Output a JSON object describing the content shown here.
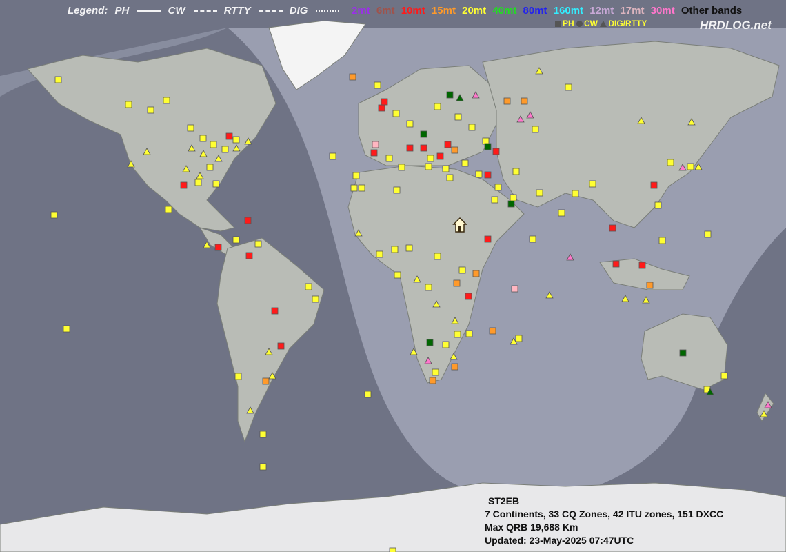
{
  "legend": {
    "label": "Legend:",
    "ph": "PH",
    "cw": "CW",
    "rtty": "RTTY",
    "dig": "DIG"
  },
  "bands": [
    {
      "label": "2mt",
      "color": "#9b30e8"
    },
    {
      "label": "6mt",
      "color": "#a0524a"
    },
    {
      "label": "10mt",
      "color": "#ff1a1a"
    },
    {
      "label": "15mt",
      "color": "#ff9a2a"
    },
    {
      "label": "20mt",
      "color": "#ffff33"
    },
    {
      "label": "40mt",
      "color": "#22dd22"
    },
    {
      "label": "80mt",
      "color": "#2222ee"
    },
    {
      "label": "160mt",
      "color": "#33eeff"
    },
    {
      "label": "12mt",
      "color": "#d9b3e6"
    },
    {
      "label": "17mt",
      "color": "#f0c0c8"
    },
    {
      "label": "30mt",
      "color": "#ff77cc"
    },
    {
      "label": "Other bands",
      "color": "#111111"
    }
  ],
  "modes": {
    "ph": "PH",
    "cw": "CW",
    "dig": "DIG/RTTY"
  },
  "brand": "HRDLOG.net",
  "info": {
    "callsign": "ST2EB",
    "stats": "7 Continents, 33 CQ Zones, 42 ITU zones, 151 DXCC",
    "max_qrb": "Max QRB 19,688 Km",
    "updated": "Updated: 23-May-2025 07:47UTC"
  },
  "colors": {
    "ocean_night": "#6f7385",
    "ocean_day": "#9a9eb0",
    "land": "#b9bcb6",
    "land_edge": "#7a7e78",
    "greenland": "#f4f4f4",
    "antarctica": "#e8e8ea"
  }
}
